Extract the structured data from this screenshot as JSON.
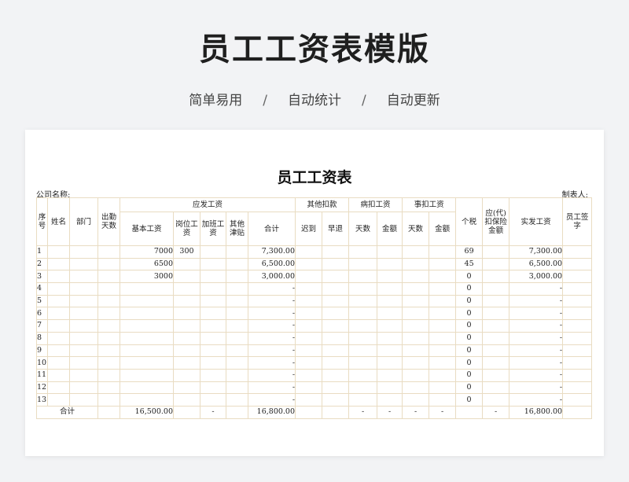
{
  "header": {
    "title": "员工工资表模版",
    "features": [
      "简单易用",
      "自动统计",
      "自动更新"
    ],
    "separator": "/"
  },
  "document": {
    "title": "员工工资表",
    "company_label": "公司名称:",
    "creator_label": "制表人:"
  },
  "table": {
    "groups": {
      "payable": "应发工资",
      "other_deduct": "其他扣款",
      "sick_deduct": "病扣工资",
      "leave_deduct": "事扣工资"
    },
    "columns": {
      "seq": "序号",
      "name": "姓名",
      "dept": "部门",
      "days": "出勤天数",
      "base": "基本工资",
      "post": "岗位工资",
      "overtime": "加班工资",
      "allowance": "其他津贴",
      "subtotal": "合计",
      "late": "迟到",
      "early": "早退",
      "sick_days": "天数",
      "sick_amount": "金额",
      "leave_days": "天数",
      "leave_amount": "金额",
      "tax": "个税",
      "insurance": "应(代)扣保险金额",
      "net": "实发工资",
      "sign": "员工签字"
    },
    "rows": [
      {
        "seq": "1",
        "base": "7000",
        "post": "300",
        "subtotal": "7,300.00",
        "tax": "69",
        "net": "7,300.00"
      },
      {
        "seq": "2",
        "base": "6500",
        "post": "",
        "subtotal": "6,500.00",
        "tax": "45",
        "net": "6,500.00"
      },
      {
        "seq": "3",
        "base": "3000",
        "post": "",
        "subtotal": "3,000.00",
        "tax": "0",
        "net": "3,000.00"
      },
      {
        "seq": "4",
        "base": "",
        "post": "",
        "subtotal": "-",
        "tax": "0",
        "net": "-"
      },
      {
        "seq": "5",
        "base": "",
        "post": "",
        "subtotal": "-",
        "tax": "0",
        "net": "-"
      },
      {
        "seq": "6",
        "base": "",
        "post": "",
        "subtotal": "-",
        "tax": "0",
        "net": "-"
      },
      {
        "seq": "7",
        "base": "",
        "post": "",
        "subtotal": "-",
        "tax": "0",
        "net": "-"
      },
      {
        "seq": "8",
        "base": "",
        "post": "",
        "subtotal": "-",
        "tax": "0",
        "net": "-"
      },
      {
        "seq": "9",
        "base": "",
        "post": "",
        "subtotal": "-",
        "tax": "0",
        "net": "-"
      },
      {
        "seq": "10",
        "base": "",
        "post": "",
        "subtotal": "-",
        "tax": "0",
        "net": "-"
      },
      {
        "seq": "11",
        "base": "",
        "post": "",
        "subtotal": "-",
        "tax": "0",
        "net": "-"
      },
      {
        "seq": "12",
        "base": "",
        "post": "",
        "subtotal": "-",
        "tax": "0",
        "net": "-"
      },
      {
        "seq": "13",
        "base": "",
        "post": "",
        "subtotal": "-",
        "tax": "0",
        "net": "-"
      }
    ],
    "total": {
      "label": "合计",
      "base": "16,500.00",
      "overtime": "-",
      "subtotal": "16,800.00",
      "sick_days": "-",
      "sick_amount": "-",
      "leave_days": "-",
      "leave_amount": "-",
      "insurance": "-",
      "net": "16,800.00"
    }
  },
  "colors": {
    "page_bg": "#f2f3f5",
    "card_bg": "#ffffff",
    "grid_line": "#e9dcc2",
    "border": "#333333"
  }
}
